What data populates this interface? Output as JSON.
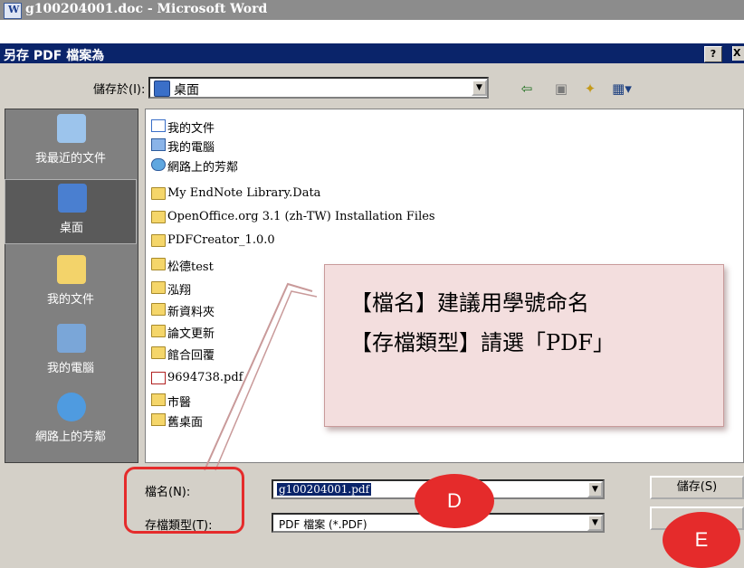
{
  "window": {
    "title": "g100204001.doc - Microsoft Word"
  },
  "dialog": {
    "title": "另存 PDF 檔案為",
    "help_label": "?",
    "close_label": "X",
    "save_in_label": "儲存於(I):",
    "save_in_value": "桌面",
    "dropdown_arrow": "▼",
    "toolbar": {
      "back": "⇦",
      "up": "▣",
      "new_folder": "✦",
      "views": "▦▾"
    }
  },
  "places": [
    {
      "label": "我最近的文件",
      "icon": "recent-icon",
      "color": "#9cc4ec"
    },
    {
      "label": "桌面",
      "icon": "desktop-icon",
      "color": "#4a7fd0"
    },
    {
      "label": "我的文件",
      "icon": "my-documents-icon",
      "color": "#f3d36a"
    },
    {
      "label": "我的電腦",
      "icon": "my-computer-icon",
      "color": "#7aa6d8"
    },
    {
      "label": "網路上的芳鄰",
      "icon": "network-icon",
      "color": "#4f9be0"
    }
  ],
  "files": [
    {
      "name": "我的文件",
      "type": "doc"
    },
    {
      "name": "我的電腦",
      "type": "pc"
    },
    {
      "name": "網路上的芳鄰",
      "type": "net"
    },
    {
      "name": "My EndNote Library.Data",
      "type": "folder"
    },
    {
      "name": "OpenOffice.org 3.1 (zh-TW) Installation Files",
      "type": "folder"
    },
    {
      "name": "PDFCreator_1.0.0",
      "type": "folder"
    },
    {
      "name": "松德test",
      "type": "folder"
    },
    {
      "name": "泓翔",
      "type": "folder"
    },
    {
      "name": "新資料夾",
      "type": "folder"
    },
    {
      "name": "論文更新",
      "type": "folder"
    },
    {
      "name": "館合回覆",
      "type": "folder"
    },
    {
      "name": "9694738.pdf",
      "type": "pdf"
    },
    {
      "name": "市醫",
      "type": "shortcut"
    },
    {
      "name": "舊桌面",
      "type": "shortcut"
    }
  ],
  "bottom": {
    "filename_label": "檔名(N):",
    "filename_value": "g100204001.pdf",
    "filetype_label": "存檔類型(T):",
    "filetype_value": "PDF 檔案 (*.PDF)",
    "save_button": "儲存(S)"
  },
  "annotation": {
    "line1": "【檔名】建議用學號命名",
    "line2": "【存檔類型】請選「PDF」",
    "marker_d": "D",
    "marker_e": "E",
    "accent_color": "#e52b2b"
  }
}
